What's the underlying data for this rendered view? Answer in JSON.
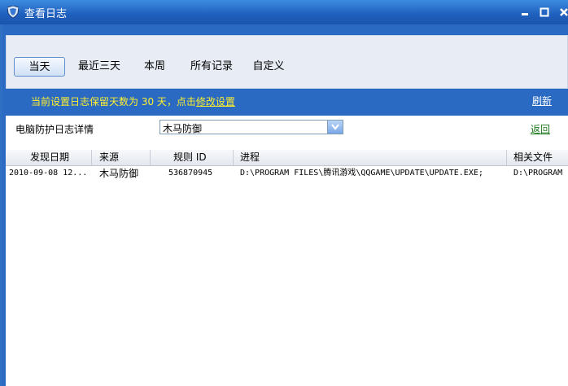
{
  "window": {
    "title": "查看日志"
  },
  "toolbar": {
    "tabs": [
      "当天",
      "最近三天",
      "本周",
      "所有记录",
      "自定义"
    ]
  },
  "info": {
    "text": "当前设置日志保留天数为 30 天，点击",
    "link": "修改设置",
    "refresh": "刷新"
  },
  "detail": {
    "label": "电脑防护日志详情",
    "selected": "木马防御",
    "back": "返回"
  },
  "table": {
    "headers": [
      "发现日期",
      "来源",
      "规则 ID",
      "进程",
      "相关文件"
    ],
    "rows": [
      [
        "2010-09-08 12...",
        "木马防御",
        "536870945",
        "D:\\PROGRAM FILES\\腾讯游戏\\QQGAME\\UPDATE\\UPDATE.EXE;",
        "D:\\PROGRAM"
      ]
    ]
  },
  "colors": {
    "accent": "#2f6fc4",
    "info_text": "#ffef2e",
    "back_link": "#1a7a1a"
  }
}
